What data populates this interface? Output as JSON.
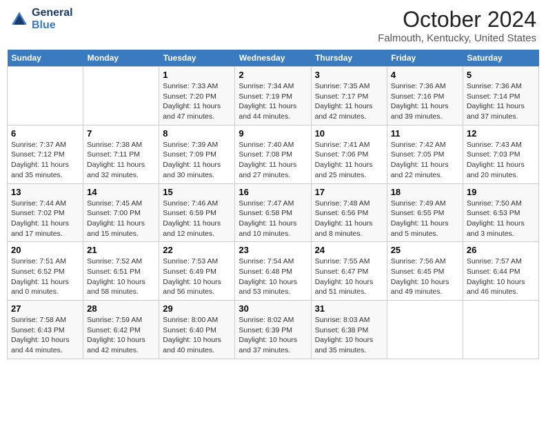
{
  "header": {
    "logo_line1": "General",
    "logo_line2": "Blue",
    "title": "October 2024",
    "subtitle": "Falmouth, Kentucky, United States"
  },
  "weekdays": [
    "Sunday",
    "Monday",
    "Tuesday",
    "Wednesday",
    "Thursday",
    "Friday",
    "Saturday"
  ],
  "weeks": [
    [
      {
        "day": "",
        "info": ""
      },
      {
        "day": "",
        "info": ""
      },
      {
        "day": "1",
        "info": "Sunrise: 7:33 AM\nSunset: 7:20 PM\nDaylight: 11 hours and 47 minutes."
      },
      {
        "day": "2",
        "info": "Sunrise: 7:34 AM\nSunset: 7:19 PM\nDaylight: 11 hours and 44 minutes."
      },
      {
        "day": "3",
        "info": "Sunrise: 7:35 AM\nSunset: 7:17 PM\nDaylight: 11 hours and 42 minutes."
      },
      {
        "day": "4",
        "info": "Sunrise: 7:36 AM\nSunset: 7:16 PM\nDaylight: 11 hours and 39 minutes."
      },
      {
        "day": "5",
        "info": "Sunrise: 7:36 AM\nSunset: 7:14 PM\nDaylight: 11 hours and 37 minutes."
      }
    ],
    [
      {
        "day": "6",
        "info": "Sunrise: 7:37 AM\nSunset: 7:12 PM\nDaylight: 11 hours and 35 minutes."
      },
      {
        "day": "7",
        "info": "Sunrise: 7:38 AM\nSunset: 7:11 PM\nDaylight: 11 hours and 32 minutes."
      },
      {
        "day": "8",
        "info": "Sunrise: 7:39 AM\nSunset: 7:09 PM\nDaylight: 11 hours and 30 minutes."
      },
      {
        "day": "9",
        "info": "Sunrise: 7:40 AM\nSunset: 7:08 PM\nDaylight: 11 hours and 27 minutes."
      },
      {
        "day": "10",
        "info": "Sunrise: 7:41 AM\nSunset: 7:06 PM\nDaylight: 11 hours and 25 minutes."
      },
      {
        "day": "11",
        "info": "Sunrise: 7:42 AM\nSunset: 7:05 PM\nDaylight: 11 hours and 22 minutes."
      },
      {
        "day": "12",
        "info": "Sunrise: 7:43 AM\nSunset: 7:03 PM\nDaylight: 11 hours and 20 minutes."
      }
    ],
    [
      {
        "day": "13",
        "info": "Sunrise: 7:44 AM\nSunset: 7:02 PM\nDaylight: 11 hours and 17 minutes."
      },
      {
        "day": "14",
        "info": "Sunrise: 7:45 AM\nSunset: 7:00 PM\nDaylight: 11 hours and 15 minutes."
      },
      {
        "day": "15",
        "info": "Sunrise: 7:46 AM\nSunset: 6:59 PM\nDaylight: 11 hours and 12 minutes."
      },
      {
        "day": "16",
        "info": "Sunrise: 7:47 AM\nSunset: 6:58 PM\nDaylight: 11 hours and 10 minutes."
      },
      {
        "day": "17",
        "info": "Sunrise: 7:48 AM\nSunset: 6:56 PM\nDaylight: 11 hours and 8 minutes."
      },
      {
        "day": "18",
        "info": "Sunrise: 7:49 AM\nSunset: 6:55 PM\nDaylight: 11 hours and 5 minutes."
      },
      {
        "day": "19",
        "info": "Sunrise: 7:50 AM\nSunset: 6:53 PM\nDaylight: 11 hours and 3 minutes."
      }
    ],
    [
      {
        "day": "20",
        "info": "Sunrise: 7:51 AM\nSunset: 6:52 PM\nDaylight: 11 hours and 0 minutes."
      },
      {
        "day": "21",
        "info": "Sunrise: 7:52 AM\nSunset: 6:51 PM\nDaylight: 10 hours and 58 minutes."
      },
      {
        "day": "22",
        "info": "Sunrise: 7:53 AM\nSunset: 6:49 PM\nDaylight: 10 hours and 56 minutes."
      },
      {
        "day": "23",
        "info": "Sunrise: 7:54 AM\nSunset: 6:48 PM\nDaylight: 10 hours and 53 minutes."
      },
      {
        "day": "24",
        "info": "Sunrise: 7:55 AM\nSunset: 6:47 PM\nDaylight: 10 hours and 51 minutes."
      },
      {
        "day": "25",
        "info": "Sunrise: 7:56 AM\nSunset: 6:45 PM\nDaylight: 10 hours and 49 minutes."
      },
      {
        "day": "26",
        "info": "Sunrise: 7:57 AM\nSunset: 6:44 PM\nDaylight: 10 hours and 46 minutes."
      }
    ],
    [
      {
        "day": "27",
        "info": "Sunrise: 7:58 AM\nSunset: 6:43 PM\nDaylight: 10 hours and 44 minutes."
      },
      {
        "day": "28",
        "info": "Sunrise: 7:59 AM\nSunset: 6:42 PM\nDaylight: 10 hours and 42 minutes."
      },
      {
        "day": "29",
        "info": "Sunrise: 8:00 AM\nSunset: 6:40 PM\nDaylight: 10 hours and 40 minutes."
      },
      {
        "day": "30",
        "info": "Sunrise: 8:02 AM\nSunset: 6:39 PM\nDaylight: 10 hours and 37 minutes."
      },
      {
        "day": "31",
        "info": "Sunrise: 8:03 AM\nSunset: 6:38 PM\nDaylight: 10 hours and 35 minutes."
      },
      {
        "day": "",
        "info": ""
      },
      {
        "day": "",
        "info": ""
      }
    ]
  ]
}
